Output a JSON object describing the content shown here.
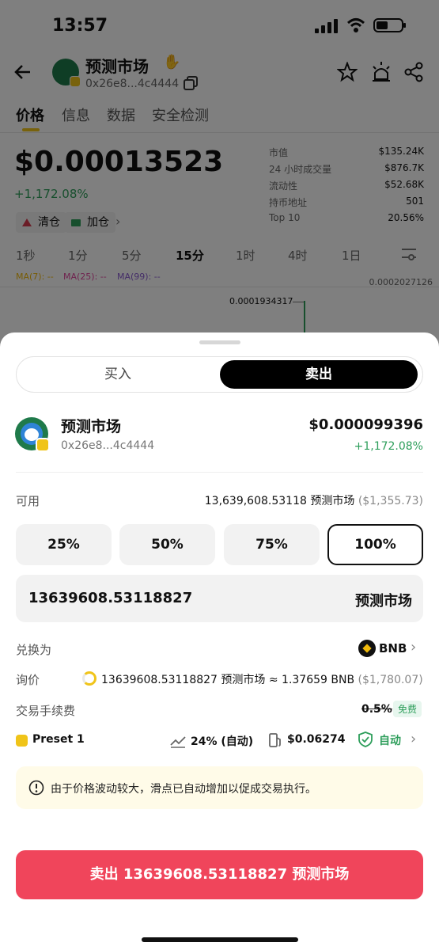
{
  "status_bar": {
    "time": "13:57"
  },
  "header": {
    "title": "预测市场",
    "address": "0x26e8...4c4444"
  },
  "tabs": [
    {
      "label": "价格"
    },
    {
      "label": "信息"
    },
    {
      "label": "数据"
    },
    {
      "label": "安全检测"
    }
  ],
  "overview": {
    "price": "$0.00013523",
    "change": "+1,172.08%",
    "chips": [
      {
        "label": "清仓"
      },
      {
        "label": "加仓"
      }
    ],
    "stats": [
      {
        "key": "市值",
        "value": "$135.24K"
      },
      {
        "key": "24 小时成交量",
        "value": "$876.7K"
      },
      {
        "key": "流动性",
        "value": "$52.68K"
      },
      {
        "key": "持币地址",
        "value": "501"
      },
      {
        "key": "Top 10",
        "value": "20.56%"
      }
    ]
  },
  "timeframes": [
    {
      "label": "1秒"
    },
    {
      "label": "1分"
    },
    {
      "label": "5分"
    },
    {
      "label": "15分"
    },
    {
      "label": "1时"
    },
    {
      "label": "4时"
    },
    {
      "label": "1日"
    }
  ],
  "chart": {
    "ma7": "MA(7): --",
    "ma25": "MA(25): --",
    "ma99": "MA(99): --",
    "axis_top": "0.0002027126",
    "high_label": "0.0001934317",
    "colors": {
      "ma7": "#f0b90b",
      "ma25": "#e0479e",
      "ma99": "#8a5cd1",
      "up": "#2e9e5b"
    }
  },
  "sheet": {
    "segment": {
      "buy": "买入",
      "sell": "卖出"
    },
    "token": {
      "name": "预测市场",
      "address": "0x26e8...4c4444",
      "price": "$0.000099396",
      "change": "+1,172.08%"
    },
    "available": {
      "label": "可用",
      "amount": "13,639,608.53118 预测市场",
      "usd": "($1,355.73)"
    },
    "percents": [
      "25%",
      "50%",
      "75%",
      "100%"
    ],
    "amount_input": {
      "value": "13639608.53118827",
      "unit": "预测市场"
    },
    "convert_to": {
      "label": "兑换为",
      "token": "BNB"
    },
    "quote": {
      "label": "询价",
      "value": "13639608.53118827 预测市场 ≈ 1.37659 BNB",
      "usd": "($1,780.07)"
    },
    "fee": {
      "label": "交易手续费",
      "old": "0.5%",
      "badge": "免费"
    },
    "settings": {
      "preset": "Preset 1",
      "slippage": "24% (自动)",
      "gas": "$0.06274",
      "mev": "自动"
    },
    "warning": "由于价格波动较大，滑点已自动增加以促成交易执行。",
    "cta": "卖出 13639608.53118827 预测市场"
  },
  "theme": {
    "sell_button": "#f0455b",
    "positive": "#2e9e5b",
    "accent": "#f0c419"
  }
}
